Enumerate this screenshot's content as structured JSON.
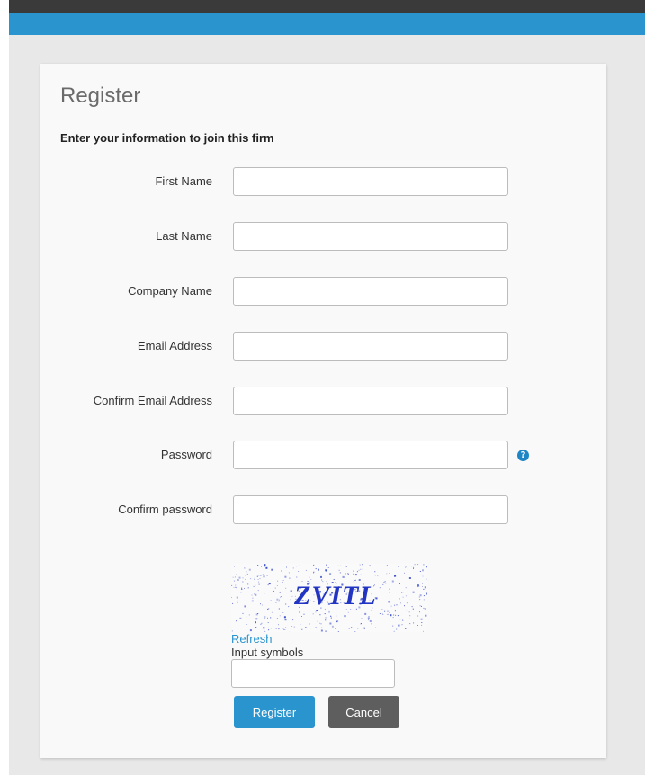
{
  "header": {
    "accent_color": "#2a94cf",
    "topbar_color": "#3a3a3a"
  },
  "form": {
    "title": "Register",
    "subtitle": "Enter your information to join this firm",
    "fields": [
      {
        "label": "First Name",
        "value": ""
      },
      {
        "label": "Last Name",
        "value": ""
      },
      {
        "label": "Company Name",
        "value": ""
      },
      {
        "label": "Email Address",
        "value": ""
      },
      {
        "label": "Confirm Email Address",
        "value": ""
      },
      {
        "label": "Password",
        "value": "",
        "help_icon": "question-circle-icon"
      },
      {
        "label": "Confirm password",
        "value": ""
      }
    ],
    "captcha": {
      "text": "ZVITL",
      "refresh_label": "Refresh",
      "input_label": "Input symbols",
      "input_value": ""
    },
    "buttons": {
      "register_label": "Register",
      "cancel_label": "Cancel"
    }
  }
}
